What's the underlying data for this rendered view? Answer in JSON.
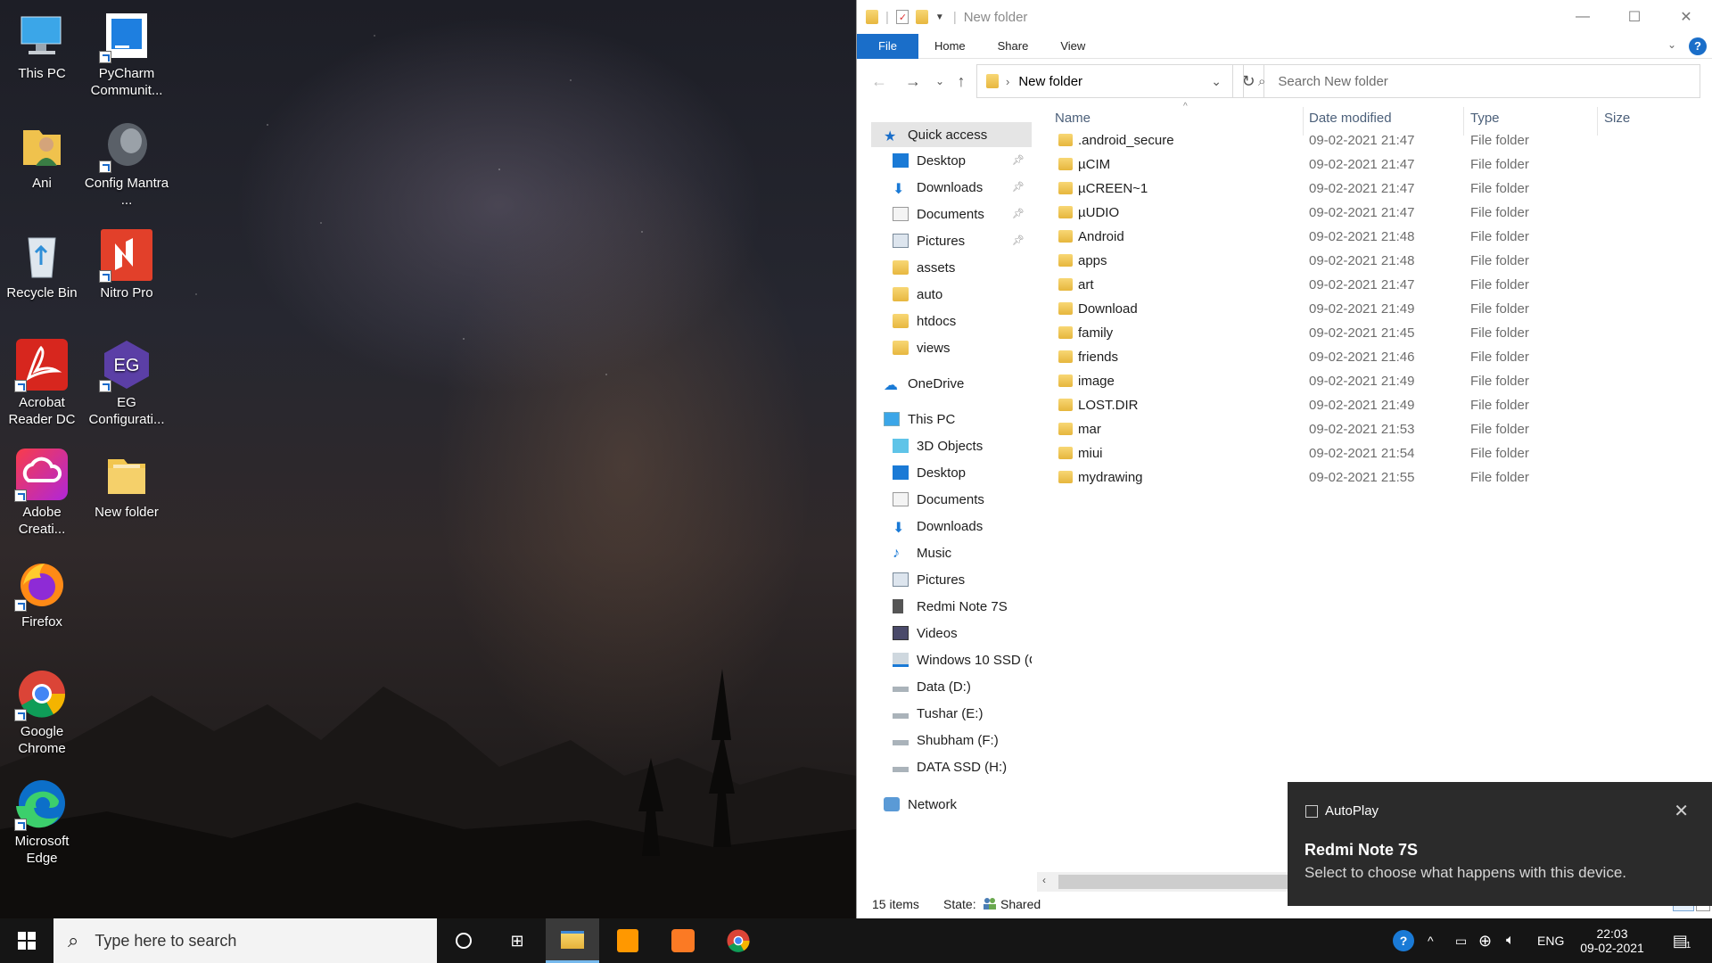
{
  "desktop": {
    "icons": [
      {
        "label": "This PC"
      },
      {
        "label": "PyCharm Communit..."
      },
      {
        "label": "Ani"
      },
      {
        "label": "Config Mantra ..."
      },
      {
        "label": "Recycle Bin"
      },
      {
        "label": "Nitro Pro"
      },
      {
        "label": "Acrobat Reader DC"
      },
      {
        "label": "EG Configurati..."
      },
      {
        "label": "Adobe Creati..."
      },
      {
        "label": "New folder"
      },
      {
        "label": "Firefox"
      },
      {
        "label": "Google Chrome"
      },
      {
        "label": "Microsoft Edge"
      }
    ]
  },
  "explorer": {
    "title": "New folder",
    "ribbon_tabs": [
      "File",
      "Home",
      "Share",
      "View"
    ],
    "address": "New folder",
    "search_placeholder": "Search New folder",
    "columns": {
      "name": "Name",
      "date": "Date modified",
      "type": "Type",
      "size": "Size"
    },
    "nav": {
      "quick_access": "Quick access",
      "quick_items": [
        "Desktop",
        "Downloads",
        "Documents",
        "Pictures",
        "assets",
        "auto",
        "htdocs",
        "views"
      ],
      "onedrive": "OneDrive",
      "this_pc": "This PC",
      "pc_items": [
        "3D Objects",
        "Desktop",
        "Documents",
        "Downloads",
        "Music",
        "Pictures",
        "Redmi Note 7S",
        "Videos",
        "Windows 10 SSD (C",
        "Data (D:)",
        "Tushar (E:)",
        "Shubham (F:)",
        "DATA SSD (H:)"
      ],
      "network": "Network"
    },
    "files": [
      {
        "name": ".android_secure",
        "date": "09-02-2021 21:47",
        "type": "File folder"
      },
      {
        "name": "µCIM",
        "date": "09-02-2021 21:47",
        "type": "File folder"
      },
      {
        "name": "µCREEN~1",
        "date": "09-02-2021 21:47",
        "type": "File folder"
      },
      {
        "name": "µUDIO",
        "date": "09-02-2021 21:47",
        "type": "File folder"
      },
      {
        "name": "Android",
        "date": "09-02-2021 21:48",
        "type": "File folder"
      },
      {
        "name": "apps",
        "date": "09-02-2021 21:48",
        "type": "File folder"
      },
      {
        "name": "art",
        "date": "09-02-2021 21:47",
        "type": "File folder"
      },
      {
        "name": "Download",
        "date": "09-02-2021 21:49",
        "type": "File folder"
      },
      {
        "name": "family",
        "date": "09-02-2021 21:45",
        "type": "File folder"
      },
      {
        "name": "friends",
        "date": "09-02-2021 21:46",
        "type": "File folder"
      },
      {
        "name": "image",
        "date": "09-02-2021 21:49",
        "type": "File folder"
      },
      {
        "name": "LOST.DIR",
        "date": "09-02-2021 21:49",
        "type": "File folder"
      },
      {
        "name": "mar",
        "date": "09-02-2021 21:53",
        "type": "File folder"
      },
      {
        "name": "miui",
        "date": "09-02-2021 21:54",
        "type": "File folder"
      },
      {
        "name": "mydrawing",
        "date": "09-02-2021 21:55",
        "type": "File folder"
      }
    ],
    "status": {
      "count": "15 items",
      "state_label": "State:",
      "state_value": "Shared"
    }
  },
  "toast": {
    "app": "AutoPlay",
    "title": "Redmi Note 7S",
    "message": "Select to choose what happens with this device."
  },
  "taskbar": {
    "search_placeholder": "Type here to search",
    "lang": "ENG",
    "time": "22:03",
    "date": "09-02-2021",
    "notif_count": "1"
  },
  "colors": {
    "accent": "#1a6ec9",
    "taskbar": "#151515",
    "toast": "#2b2b2b"
  }
}
